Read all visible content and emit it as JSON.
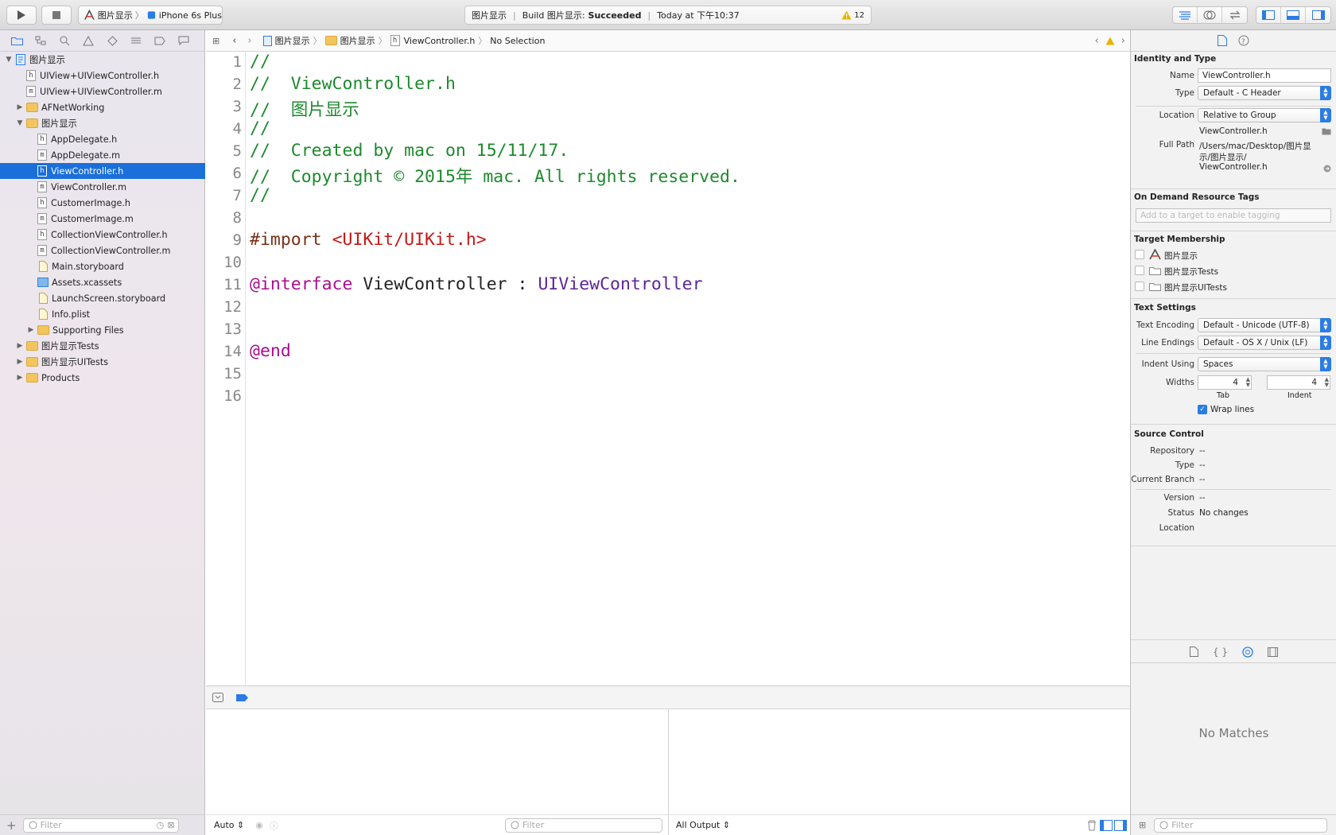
{
  "toolbar": {
    "scheme_project": "图片显示",
    "scheme_device": "iPhone 6s Plus",
    "status_project": "图片显示",
    "status_build_prefix": "Build 图片显示:",
    "status_build_result": "Succeeded",
    "status_time": "Today at 下午10:37",
    "warning_count": "12"
  },
  "navigator": {
    "items": [
      {
        "label": "图片显示",
        "indent": 0,
        "kind": "project",
        "disclosure": "open"
      },
      {
        "label": "UIView+UIViewController.h",
        "indent": 1,
        "kind": "h"
      },
      {
        "label": "UIView+UIViewController.m",
        "indent": 1,
        "kind": "m"
      },
      {
        "label": "AFNetWorking",
        "indent": 1,
        "kind": "folder",
        "disclosure": "closed"
      },
      {
        "label": "图片显示",
        "indent": 1,
        "kind": "folder",
        "disclosure": "open"
      },
      {
        "label": "AppDelegate.h",
        "indent": 2,
        "kind": "h"
      },
      {
        "label": "AppDelegate.m",
        "indent": 2,
        "kind": "m"
      },
      {
        "label": "ViewController.h",
        "indent": 2,
        "kind": "h",
        "selected": true
      },
      {
        "label": "ViewController.m",
        "indent": 2,
        "kind": "m"
      },
      {
        "label": "CustomerImage.h",
        "indent": 2,
        "kind": "h"
      },
      {
        "label": "CustomerImage.m",
        "indent": 2,
        "kind": "m"
      },
      {
        "label": "CollectionViewController.h",
        "indent": 2,
        "kind": "h"
      },
      {
        "label": "CollectionViewController.m",
        "indent": 2,
        "kind": "m"
      },
      {
        "label": "Main.storyboard",
        "indent": 2,
        "kind": "doc"
      },
      {
        "label": "Assets.xcassets",
        "indent": 2,
        "kind": "assets"
      },
      {
        "label": "LaunchScreen.storyboard",
        "indent": 2,
        "kind": "doc"
      },
      {
        "label": "Info.plist",
        "indent": 2,
        "kind": "doc"
      },
      {
        "label": "Supporting Files",
        "indent": 2,
        "kind": "folder",
        "disclosure": "closed"
      },
      {
        "label": "图片显示Tests",
        "indent": 1,
        "kind": "folder",
        "disclosure": "closed"
      },
      {
        "label": "图片显示UITests",
        "indent": 1,
        "kind": "folder",
        "disclosure": "closed"
      },
      {
        "label": "Products",
        "indent": 1,
        "kind": "folder",
        "disclosure": "closed"
      }
    ],
    "filter_placeholder": "Filter"
  },
  "jumpbar": {
    "crumb1": "图片显示",
    "crumb2": "图片显示",
    "crumb3": "ViewController.h",
    "crumb4": "No Selection"
  },
  "editor": {
    "line_numbers": [
      "1",
      "2",
      "3",
      "4",
      "5",
      "6",
      "7",
      "8",
      "9",
      "10",
      "11",
      "12",
      "13",
      "14",
      "15",
      "16"
    ],
    "l1": "//",
    "l2": "//  ViewController.h",
    "l3": "//  图片显示",
    "l4": "//",
    "l5": "//  Created by mac on 15/11/17.",
    "l6": "//  Copyright © 2015年 mac. All rights reserved.",
    "l7": "//",
    "l9_kw": "#import ",
    "l9_str": "<UIKit/UIKit.h>",
    "l11_kw": "@interface",
    "l11_name": " ViewController : ",
    "l11_super": "UIViewController",
    "l14_kw": "@end"
  },
  "debug": {
    "auto_label": "Auto",
    "left_filter_placeholder": "Filter",
    "output_label": "All Output"
  },
  "inspector": {
    "identity_header": "Identity and Type",
    "name_label": "Name",
    "name_value": "ViewController.h",
    "type_label": "Type",
    "type_value": "Default - C Header",
    "location_label": "Location",
    "location_value": "Relative to Group",
    "location_file": "ViewController.h",
    "fullpath_label": "Full Path",
    "fullpath_l1": "/Users/mac/Desktop/图片显",
    "fullpath_l2": "示/图片显示/",
    "fullpath_l3": "ViewController.h",
    "odr_header": "On Demand Resource Tags",
    "odr_placeholder": "Add to a target to enable tagging",
    "target_header": "Target Membership",
    "targets": [
      "图片显示",
      "图片显示Tests",
      "图片显示UITests"
    ],
    "text_header": "Text Settings",
    "encoding_label": "Text Encoding",
    "encoding_value": "Default - Unicode (UTF-8)",
    "endings_label": "Line Endings",
    "endings_value": "Default - OS X / Unix (LF)",
    "indent_label": "Indent Using",
    "indent_value": "Spaces",
    "widths_label": "Widths",
    "tab_value": "4",
    "indent_width_value": "4",
    "tab_caption": "Tab",
    "indent_caption": "Indent",
    "wrap_label": "Wrap lines",
    "sc_header": "Source Control",
    "repo_label": "Repository",
    "repo_value": "--",
    "sctype_label": "Type",
    "sctype_value": "--",
    "branch_label": "Current Branch",
    "branch_value": "--",
    "version_label": "Version",
    "version_value": "--",
    "status_label": "Status",
    "status_value": "No changes",
    "sclocation_label": "Location",
    "library_empty": "No Matches",
    "library_filter_placeholder": "Filter"
  },
  "colors": {
    "selection": "#1a6fdb",
    "comment": "#1d8a2d",
    "keyword": "#aa0d91",
    "string": "#c41a16",
    "class": "#5c2699"
  }
}
